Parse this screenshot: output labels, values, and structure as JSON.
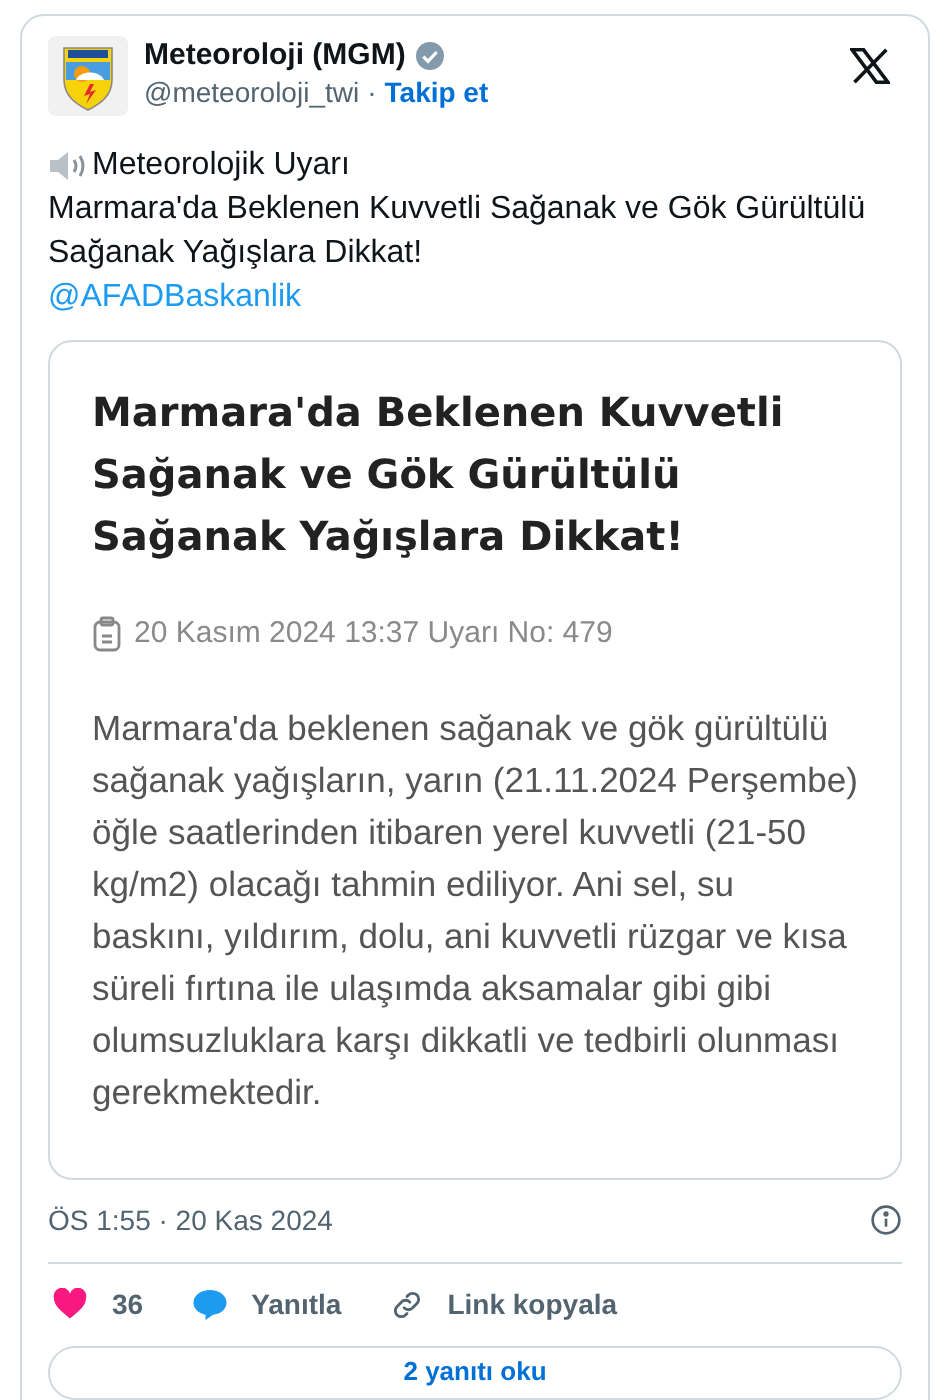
{
  "author": {
    "name": "Meteoroloji (MGM)",
    "verified": true,
    "handle": "@meteoroloji_twi",
    "separator": "·",
    "follow": "Takip et"
  },
  "tweet": {
    "lines": [
      "Meteorolojik Uyarı",
      "Marmara'da Beklenen Kuvvetli Sağanak ve Gök Gürültülü Sağanak Yağışlara Dikkat!"
    ],
    "mention": "@AFADBaskanlik"
  },
  "warning_card": {
    "title": "Marmara'da Beklenen Kuvvetli Sağanak ve Gök Gürültülü Sağanak Yağışlara Dikkat!",
    "meta": "20 Kasım 2024 13:37 Uyarı No: 479",
    "body": "Marmara'da beklenen sağanak ve gök gürültülü sağanak yağışların, yarın (21.11.2024 Perşembe) öğle saatlerinden itibaren yerel kuvvetli (21-50 kg/m2) olacağı tahmin ediliyor. Ani sel, su baskını, yıldırım, dolu, ani kuvvetli rüzgar ve kısa süreli fırtına ile ulaşımda aksamalar gibi gibi olumsuzluklara karşı dikkatli ve tedbirli olunması gerekmektedir."
  },
  "timestamp": "ÖS 1:55 · 20 Kas 2024",
  "actions": [
    {
      "kind": "like",
      "label": "36"
    },
    {
      "kind": "reply",
      "label": "Yanıtla"
    },
    {
      "kind": "copy",
      "label": "Link kopyala"
    }
  ],
  "read_replies": "2 yanıtı oku"
}
